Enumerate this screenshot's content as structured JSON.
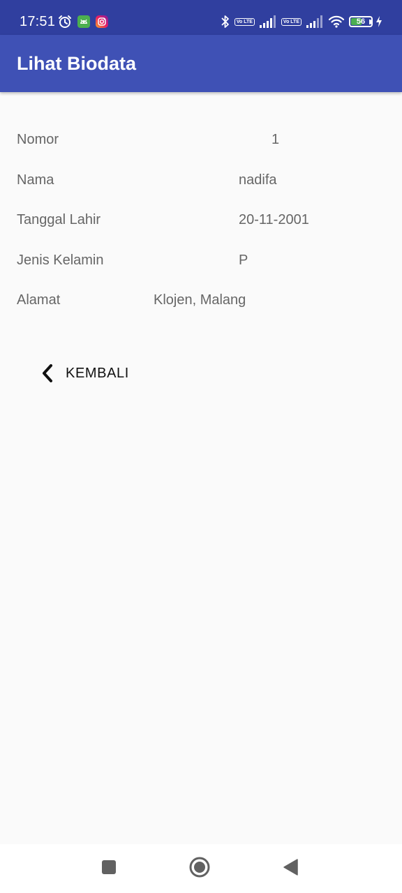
{
  "status_bar": {
    "time": "17:51",
    "battery_level": "56",
    "battery_fraction": 0.56,
    "left_icons": [
      "alarm-icon",
      "android-notification-icon",
      "instagram-icon"
    ],
    "right_icons": [
      "bluetooth-icon",
      "volte-icon",
      "signal-icon",
      "volte-icon",
      "signal-icon",
      "wifi-icon",
      "battery-icon",
      "charging-icon"
    ],
    "volte_label": "Vo LTE",
    "colors": {
      "background": "#303f9f",
      "battery_fill": "#4caf50"
    }
  },
  "app_bar": {
    "title": "Lihat Biodata",
    "color": "#3f51b5"
  },
  "biodata": {
    "rows": [
      {
        "label": "Nomor",
        "value": "1"
      },
      {
        "label": "Nama",
        "value": "nadifa"
      },
      {
        "label": "Tanggal Lahir",
        "value": "20-11-2001"
      },
      {
        "label": "Jenis Kelamin",
        "value": "P"
      },
      {
        "label": "Alamat",
        "value": "Klojen, Malang"
      }
    ]
  },
  "back_button": {
    "label": "KEMBALI",
    "icon": "chevron-left-icon"
  },
  "nav_bar": {
    "buttons": [
      "recent-apps-icon",
      "home-icon",
      "back-icon"
    ]
  }
}
